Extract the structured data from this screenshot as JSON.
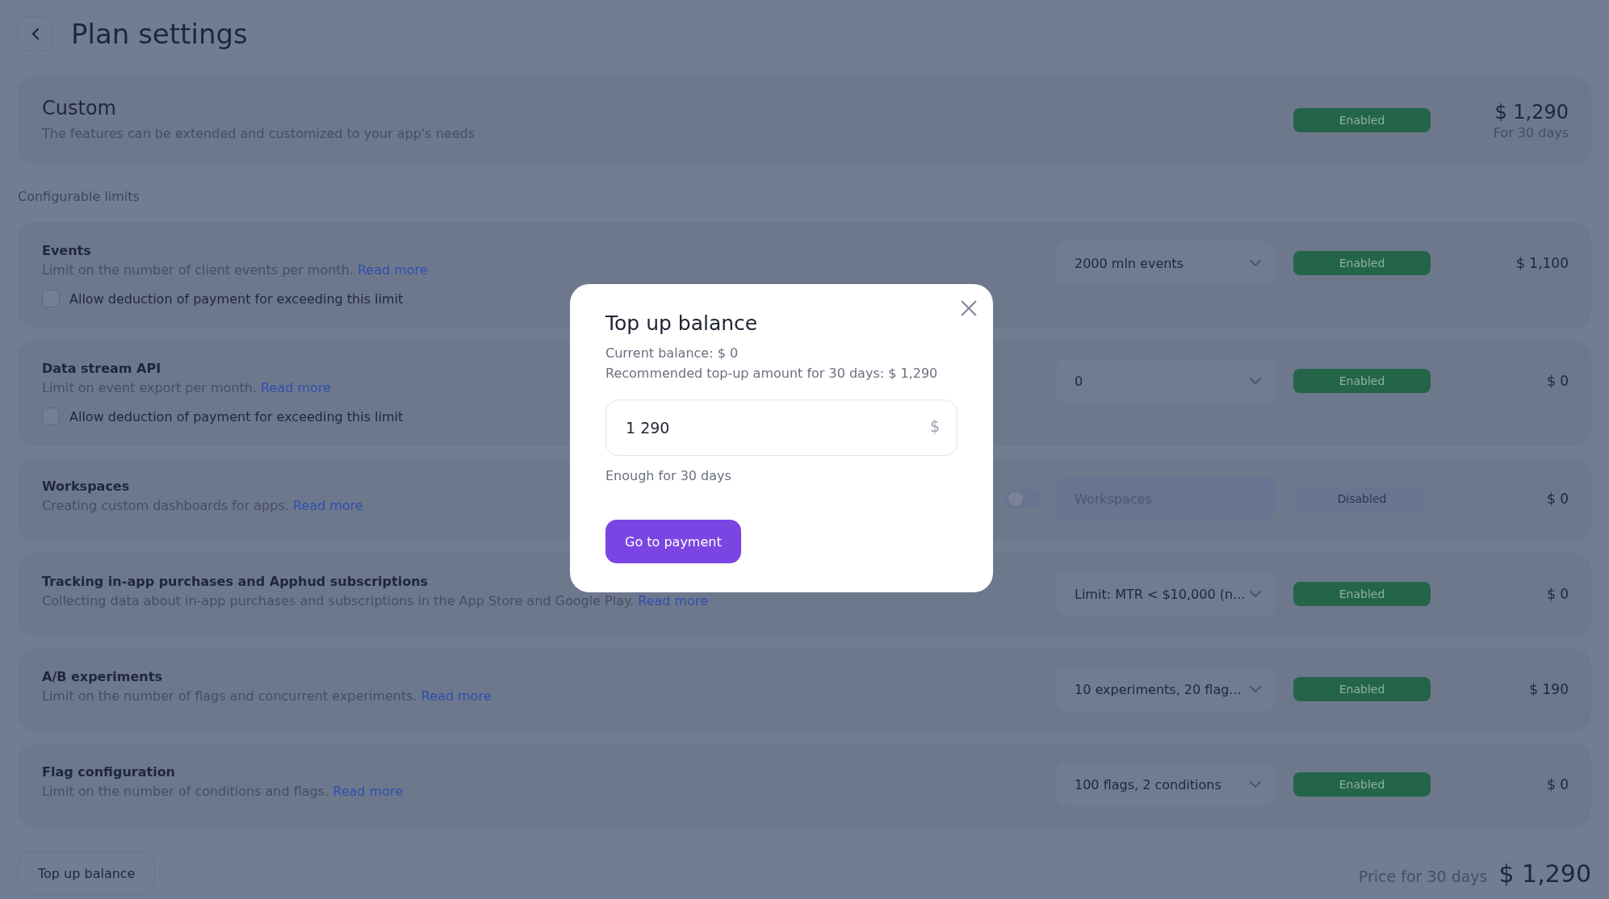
{
  "header": {
    "title": "Plan settings"
  },
  "plan": {
    "name": "Custom",
    "description": "The features can be extended and customized to your app's needs",
    "status": {
      "label": "Enabled",
      "enabled": true
    },
    "price": "$ 1,290",
    "period": "For 30 days"
  },
  "section_title": "Configurable limits",
  "limits": [
    {
      "title": "Events",
      "description": "Limit on the number of client events per month.",
      "link": "Read more",
      "checkbox": {
        "label": "Allow deduction of payment for exceeding this limit",
        "checked": false
      },
      "kind": "select",
      "value": "2000 mln events",
      "status": {
        "label": "Enabled",
        "enabled": true
      },
      "price": "$ 1,100"
    },
    {
      "title": "Data stream API",
      "description": "Limit on event export per month.",
      "link": "Read more",
      "checkbox": {
        "label": "Allow deduction of payment for exceeding this limit",
        "checked": false
      },
      "kind": "select",
      "value": "0",
      "status": {
        "label": "Enabled",
        "enabled": true
      },
      "price": "$ 0"
    },
    {
      "title": "Workspaces",
      "description": "Creating custom dashboards for apps.",
      "link": "Read more",
      "kind": "toggle",
      "on": false,
      "placeholder": "Workspaces",
      "status": {
        "label": "Disabled",
        "enabled": false
      },
      "price": "$ 0"
    },
    {
      "title": "Tracking in-app purchases and Apphud subscriptions",
      "description": "Collecting data about in-app purchases and subscriptions in the App Store and Google Play.",
      "link": "Read more",
      "kind": "select",
      "value": "Limit: MTR < $10,000 (n...",
      "status": {
        "label": "Enabled",
        "enabled": true
      },
      "price": "$ 0"
    },
    {
      "title": "A/B experiments",
      "description": "Limit on the number of flags and concurrent experiments.",
      "link": "Read more",
      "kind": "select",
      "value": "10 experiments, 20 flag...",
      "status": {
        "label": "Enabled",
        "enabled": true
      },
      "price": "$ 190"
    },
    {
      "title": "Flag configuration",
      "description": "Limit on the number of conditions and flags.",
      "link": "Read more",
      "kind": "select",
      "value": "100 flags, 2 conditions",
      "status": {
        "label": "Enabled",
        "enabled": true
      },
      "price": "$ 0"
    }
  ],
  "footer": {
    "button": "Top up balance",
    "price_label": "Price for 30 days",
    "price": "$ 1,290"
  },
  "modal": {
    "title": "Top up balance",
    "current_balance": "Current balance: $ 0",
    "recommended": "Recommended top-up amount for 30 days: $ 1,290",
    "amount": "1 290",
    "currency": "$",
    "hint": "Enough for 30 days",
    "button": "Go to payment"
  }
}
